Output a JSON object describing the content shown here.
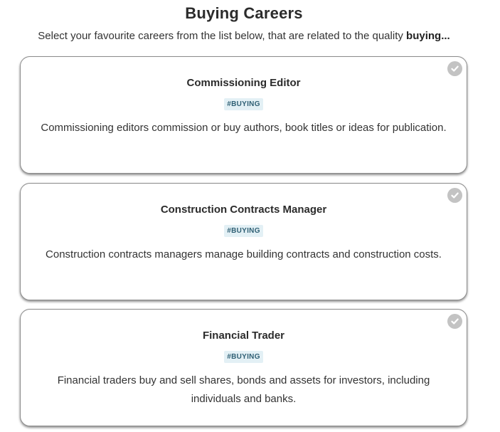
{
  "page": {
    "title": "Buying Careers",
    "subtitle_prefix": "Select your favourite careers from the list below, that are related to the quality ",
    "subtitle_quality": "buying",
    "subtitle_suffix": "..."
  },
  "cards": [
    {
      "title": "Commissioning Editor",
      "tag": "#BUYING",
      "description": "Commissioning editors commission or buy authors, book titles or ideas for publication.",
      "check_icon": "checkmark-circle-icon"
    },
    {
      "title": "Construction Contracts Manager",
      "tag": "#BUYING",
      "description": "Construction contracts managers manage building contracts and construction costs.",
      "check_icon": "checkmark-circle-icon"
    },
    {
      "title": "Financial Trader",
      "tag": "#BUYING",
      "description": "Financial traders buy and sell shares, bonds and assets for investors, including individuals and banks.",
      "check_icon": "checkmark-circle-icon"
    }
  ],
  "colors": {
    "check_unselected": "#c3c3c3",
    "tag_background": "#e3f0f5",
    "tag_text": "#2f5f74",
    "card_border": "#8c8c8c"
  }
}
